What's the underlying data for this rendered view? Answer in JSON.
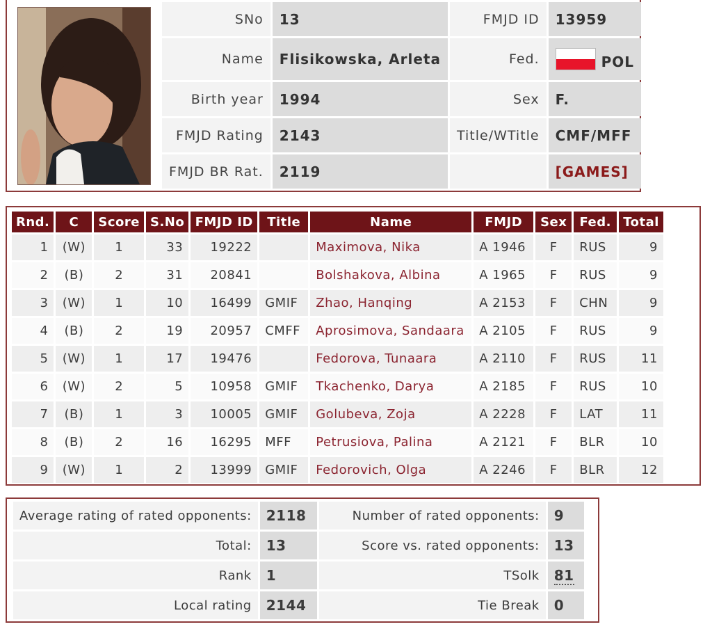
{
  "profile": {
    "sno_label": "SNo",
    "sno": "13",
    "fmjd_id_label": "FMJD ID",
    "fmjd_id": "13959",
    "name_label": "Name",
    "name": "Flisikowska, Arleta",
    "fed_label": "Fed.",
    "fed": "POL",
    "birth_year_label": "Birth year",
    "birth_year": "1994",
    "sex_label": "Sex",
    "sex": "F.",
    "rating_label": "FMJD Rating",
    "rating": "2143",
    "title_label": "Title/WTitle",
    "title": "CMF/MFF",
    "br_label": "FMJD BR Rat.",
    "br_rating": "2119",
    "games_link": "[GAMES]"
  },
  "games": {
    "headers": [
      "Rnd.",
      "C",
      "Score",
      "S.No",
      "FMJD ID",
      "Title",
      "Name",
      "FMJD",
      "Sex",
      "Fed.",
      "Total"
    ],
    "rows": [
      [
        "1",
        "(W)",
        "1",
        "33",
        "19222",
        "",
        "Maximova, Nika",
        "A 1946",
        "F",
        "RUS",
        "9"
      ],
      [
        "2",
        "(B)",
        "2",
        "31",
        "20841",
        "",
        "Bolshakova, Albina",
        "A 1965",
        "F",
        "RUS",
        "9"
      ],
      [
        "3",
        "(W)",
        "1",
        "10",
        "16499",
        "GMIF",
        "Zhao, Hanqing",
        "A 2153",
        "F",
        "CHN",
        "9"
      ],
      [
        "4",
        "(B)",
        "2",
        "19",
        "20957",
        "CMFF",
        "Aprosimova, Sandaara",
        "A 2105",
        "F",
        "RUS",
        "9"
      ],
      [
        "5",
        "(W)",
        "1",
        "17",
        "19476",
        "",
        "Fedorova, Tunaara",
        "A 2110",
        "F",
        "RUS",
        "11"
      ],
      [
        "6",
        "(W)",
        "2",
        "5",
        "10958",
        "GMIF",
        "Tkachenko, Darya",
        "A 2185",
        "F",
        "RUS",
        "10"
      ],
      [
        "7",
        "(B)",
        "1",
        "3",
        "10005",
        "GMIF",
        "Golubeva, Zoja",
        "A 2228",
        "F",
        "LAT",
        "11"
      ],
      [
        "8",
        "(B)",
        "2",
        "16",
        "16295",
        "MFF",
        "Petrusiova, Palina",
        "A 2121",
        "F",
        "BLR",
        "10"
      ],
      [
        "9",
        "(W)",
        "1",
        "2",
        "13999",
        "GMIF",
        "Fedorovich, Olga",
        "A 2246",
        "F",
        "BLR",
        "12"
      ]
    ]
  },
  "summary": {
    "avg_label": "Average rating of rated opponents:",
    "avg": "2118",
    "num_opp_label": "Number of rated opponents:",
    "num_opp": "9",
    "total_label": "Total:",
    "total": "13",
    "score_label": "Score vs. rated opponents:",
    "score": "13",
    "rank_label": "Rank",
    "rank": "1",
    "tsolk_label": "TSolk",
    "tsolk": "81",
    "local_label": "Local rating",
    "local": "2144",
    "tie_label": "Tie Break",
    "tie": "0"
  },
  "colors": {
    "header_bg": "#6e1418",
    "border": "#8c3a3a",
    "link": "#8b2430"
  },
  "icons": {
    "fed_flag": "poland-flag-icon",
    "photo": "player-photo"
  }
}
